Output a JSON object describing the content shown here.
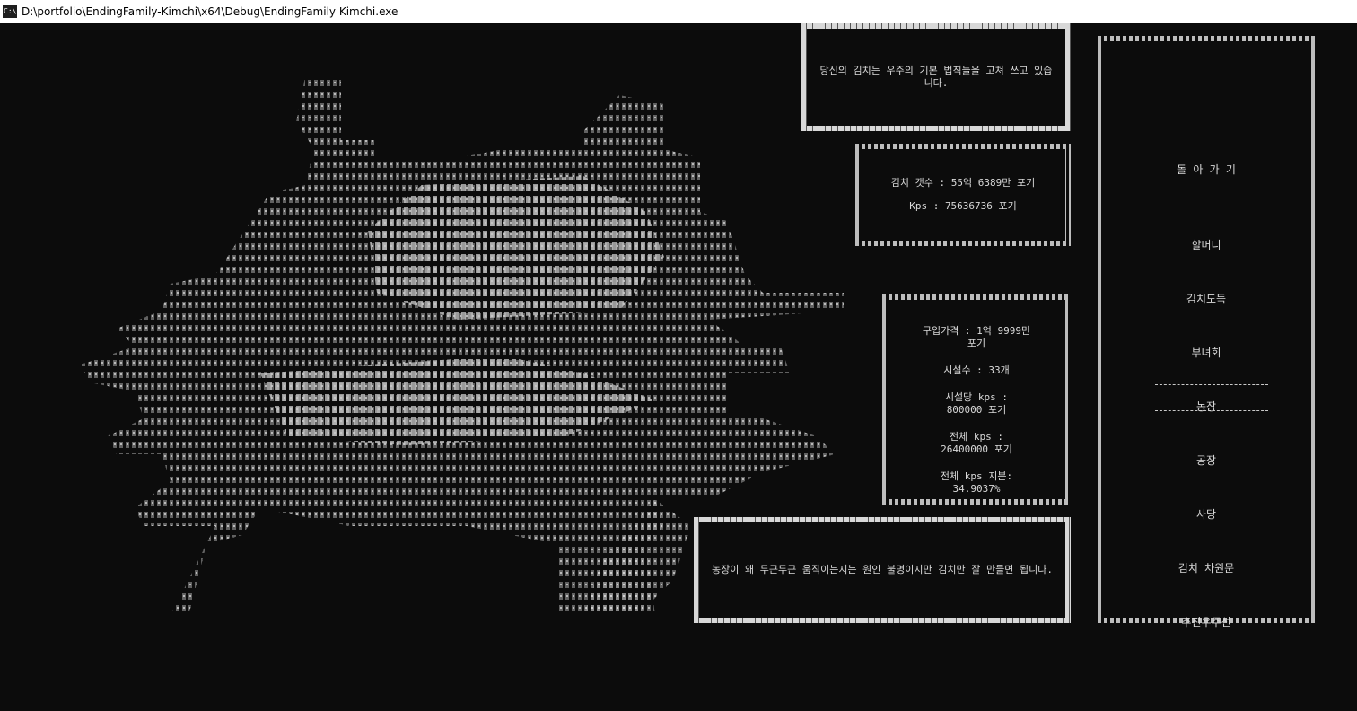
{
  "window": {
    "title": "D:\\portfolio\\EndingFamily-Kimchi\\x64\\Debug\\EndingFamily Kimchi.exe",
    "icon_name": "console-icon"
  },
  "message_top": "당신의 김치는 우주의 기본 법칙들을 고쳐 쓰고 있습니다.",
  "stats": {
    "kimchi_count": "김치 갯수 : 55억 6389만 포기",
    "kps": "Kps : 75636736 포기"
  },
  "facility": {
    "price": "구입가격 : 1억 9999만 포기",
    "count": "시설수 : 33개",
    "kps_per_label": "시설당 kps :",
    "kps_per_value": "800000 포기",
    "total_kps_label": "전체 kps :",
    "total_kps_value": "26400000 포기",
    "share_label": "전체 kps 지분:",
    "share_value": "34.9037%"
  },
  "message_bottom": "농장이 왜 두근두근 움직이는지는 원인 불명이지만 김치만 잘 만들면 됩니다.",
  "menu": {
    "items": [
      {
        "label": "돌 아 가 기"
      },
      {
        "label": "할머니"
      },
      {
        "label": "김치도둑"
      },
      {
        "label": "부녀회"
      },
      {
        "label": "농장"
      },
      {
        "label": "공장"
      },
      {
        "label": "사당"
      },
      {
        "label": "김치 차원문"
      },
      {
        "label": "추진우주선"
      }
    ],
    "selected_index": 4
  },
  "colors": {
    "background": "#0c0c0c",
    "text": "#cccccc",
    "titlebar": "#ffffff"
  }
}
